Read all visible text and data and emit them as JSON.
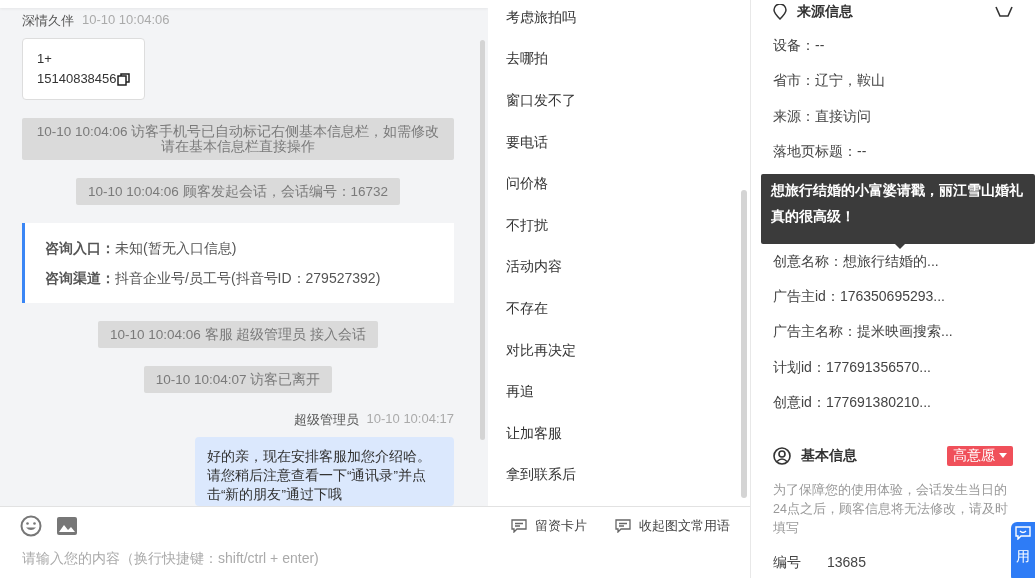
{
  "chat": {
    "messages": [
      {
        "kind": "visitor",
        "sender": "深情久伴",
        "time": "10-10 10:04:06",
        "lines": [
          "1+",
          "15140838456"
        ]
      },
      {
        "kind": "notice",
        "text": "10-10 10:04:06 访客手机号已自动标记右侧基本信息栏，如需修改请在基本信息栏直接操作"
      },
      {
        "kind": "notice",
        "text": "10-10 10:04:06 顾客发起会话，会话编号：16732"
      },
      {
        "kind": "info",
        "rows": [
          {
            "label": "咨询入口：",
            "value": "未知(暂无入口信息)"
          },
          {
            "label": "咨询渠道：",
            "value": "抖音企业号/员工号(抖音号ID：279527392)"
          }
        ]
      },
      {
        "kind": "notice",
        "text": "10-10 10:04:06 客服 超级管理员 接入会话"
      },
      {
        "kind": "notice",
        "text": "10-10 10:04:07 访客已离开"
      },
      {
        "kind": "agent",
        "sender": "超级管理员",
        "time": "10-10 10:04:17",
        "text": "好的亲，现在安排客服加您介绍哈。请您稍后注意查看一下“通讯录”并点击“新的朋友”通过下哦"
      }
    ]
  },
  "quick_replies": [
    "考虑旅拍吗",
    "去哪拍",
    "窗口发不了",
    "要电话",
    "问价格",
    "不打扰",
    "活动内容",
    "不存在",
    "对比再决定",
    "再追",
    "让加客服",
    "拿到联系后"
  ],
  "composer": {
    "actions": [
      "留资卡片",
      "收起图文常用语"
    ],
    "placeholder": "请输入您的内容（换行快捷键：shift/ctrl + enter)"
  },
  "source_info": {
    "title": "来源信息",
    "rows_before": [
      "设备：--",
      "省市：辽宁，鞍山",
      "来源：直接访问",
      "落地页标题：--"
    ],
    "tooltip": "想旅行结婚的小富婆请戳，丽江雪山婚礼真的很高级！",
    "rows_after": [
      "创意名称：想旅行结婚的...",
      "广告主id：176350695293...",
      "广告主名称：提米映画搜索...",
      "计划id：177691356570...",
      "创意id：177691380210..."
    ]
  },
  "basic_info": {
    "title": "基本信息",
    "intent_tag": "高意愿",
    "notice": "为了保障您的使用体验，会话发生当日的24点之后，顾客信息将无法修改，请及时填写",
    "fields": [
      {
        "label": "编号",
        "value": "13685"
      }
    ]
  },
  "float_button": {
    "label": "用"
  }
}
